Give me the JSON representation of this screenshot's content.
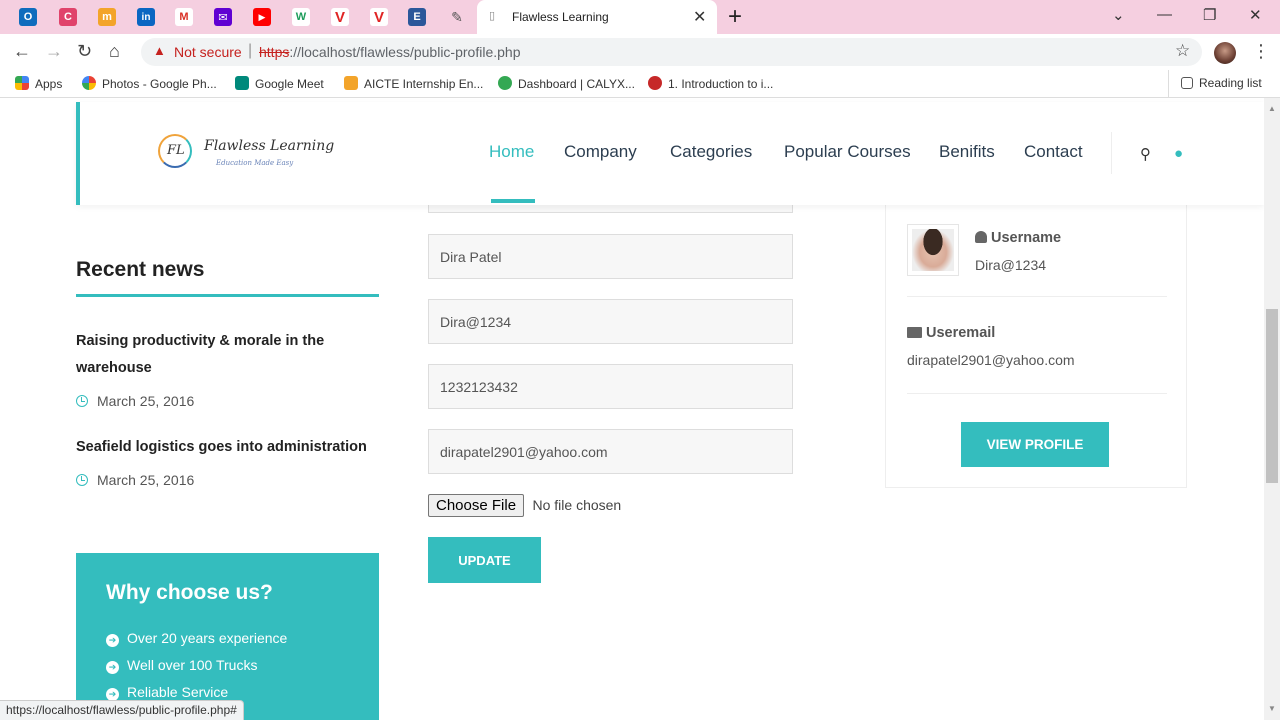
{
  "browser": {
    "tab_title": "Flawless Learning",
    "pinned_tabs": [
      {
        "icon": "outlook-icon",
        "color": "#0f6cbd",
        "glyph": "O"
      },
      {
        "icon": "app-icon",
        "color": "#e0436b",
        "glyph": "C"
      },
      {
        "icon": "app-icon",
        "color": "#f3a42a",
        "glyph": "m"
      },
      {
        "icon": "linkedin-icon",
        "color": "#0a66c2",
        "glyph": "in"
      },
      {
        "icon": "gmail-icon",
        "color": "#d93025",
        "glyph": "M"
      },
      {
        "icon": "yahoo-mail-icon",
        "color": "#6001d2",
        "glyph": "✉"
      },
      {
        "icon": "youtube-icon",
        "color": "#ff0000",
        "glyph": "▶"
      },
      {
        "icon": "w-icon",
        "color": "#1d9c5a",
        "glyph": "W"
      },
      {
        "icon": "v-icon",
        "color": "#e02424",
        "glyph": "V"
      },
      {
        "icon": "v-icon",
        "color": "#e02424",
        "glyph": "V"
      },
      {
        "icon": "doc-icon",
        "color": "#2b579a",
        "glyph": "E"
      },
      {
        "icon": "feather-icon",
        "color": "#777777",
        "glyph": "✎"
      }
    ],
    "security_label": "Not secure",
    "url_scheme": "https",
    "url_rest": "://localhost/flawless/public-profile.php",
    "bookmarks": [
      {
        "label": "Apps",
        "color": "#4285f4"
      },
      {
        "label": "Photos - Google Ph...",
        "color": "#fbbc04"
      },
      {
        "label": "Google Meet",
        "color": "#00897b"
      },
      {
        "label": "AICTE Internship En...",
        "color": "#f3a42a"
      },
      {
        "label": "Dashboard | CALYX...",
        "color": "#34a853"
      },
      {
        "label": "1. Introduction to i...",
        "color": "#c62828"
      }
    ],
    "reading_list": "Reading list",
    "status_url": "https://localhost/flawless/public-profile.php#"
  },
  "header": {
    "logo_text": "Flawless Learning",
    "logo_tagline": "Education Made Easy",
    "logo_mark": "FL",
    "menu": [
      "Home",
      "Company",
      "Categories",
      "Popular Courses",
      "Benifits",
      "Contact"
    ],
    "accent": "#34bdbe"
  },
  "sidebar": {
    "recent_title": "Recent news",
    "news": [
      {
        "title": "Raising productivity & morale in the warehouse",
        "date": "March 25, 2016"
      },
      {
        "title": "Seafield logistics goes into administration",
        "date": "March 25, 2016"
      }
    ],
    "why_title": "Why choose us?",
    "why_items": [
      "Over 20 years experience",
      "Well over 100 Trucks",
      "Reliable Service"
    ]
  },
  "form": {
    "name": "Dira Patel",
    "username": "Dira@1234",
    "phone": "1232123432",
    "email": "dirapatel2901@yahoo.com",
    "file_button": "Choose File",
    "file_status": "No file chosen",
    "update_label": "UPDATE"
  },
  "profile": {
    "username_label": "Username",
    "username": "Dira@1234",
    "email_label": "Useremail",
    "email": "dirapatel2901@yahoo.com",
    "view_label": "VIEW PROFILE"
  }
}
